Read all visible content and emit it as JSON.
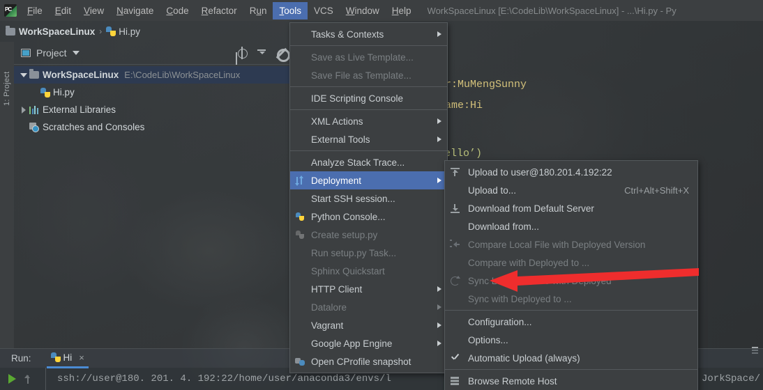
{
  "window": {
    "title": "WorkSpaceLinux [E:\\CodeLib\\WorkSpaceLinux] - ...\\Hi.py - Py"
  },
  "menubar": {
    "items": [
      {
        "label": "File",
        "mnemonic": "F"
      },
      {
        "label": "Edit",
        "mnemonic": "E"
      },
      {
        "label": "View",
        "mnemonic": "V"
      },
      {
        "label": "Navigate",
        "mnemonic": "N"
      },
      {
        "label": "Code",
        "mnemonic": "C"
      },
      {
        "label": "Refactor",
        "mnemonic": "R"
      },
      {
        "label": "Run",
        "mnemonic": "u"
      },
      {
        "label": "Tools",
        "mnemonic": "T",
        "active": true
      },
      {
        "label": "VCS",
        "mnemonic": ""
      },
      {
        "label": "Window",
        "mnemonic": "W"
      },
      {
        "label": "Help",
        "mnemonic": "H"
      }
    ]
  },
  "breadcrumb": {
    "project": "WorkSpaceLinux",
    "separator": "›",
    "file": "Hi.py"
  },
  "project_tool_window": {
    "vertical_tab": "1: Project",
    "title": "Project",
    "tree": [
      {
        "name": "WorkSpaceLinux",
        "path": "E:\\CodeLib\\WorkSpaceLinux",
        "selected": true
      },
      {
        "name": "Hi.py",
        "path": "",
        "selected": false
      },
      {
        "name": "External Libraries",
        "path": "",
        "selected": false
      },
      {
        "name": "Scratches and Consoles",
        "path": "",
        "selected": false
      }
    ]
  },
  "editor": {
    "line1": "r:MuMengSunny",
    "line2": "ame:Hi",
    "line3": "hello’)"
  },
  "tools_menu": {
    "items": [
      {
        "label": "Tasks & Contexts",
        "mnemonic": "T",
        "submenu": true,
        "disabled": false,
        "icon": ""
      },
      {
        "separator": true
      },
      {
        "label": "Save as Live Template...",
        "mnemonic": "i",
        "submenu": false,
        "disabled": true,
        "icon": ""
      },
      {
        "label": "Save File as Template...",
        "mnemonic": "l",
        "submenu": false,
        "disabled": true,
        "icon": ""
      },
      {
        "separator": true
      },
      {
        "label": "IDE Scripting Console",
        "mnemonic": "",
        "submenu": false,
        "disabled": false,
        "icon": ""
      },
      {
        "separator": true
      },
      {
        "label": "XML Actions",
        "mnemonic": "",
        "submenu": true,
        "disabled": false,
        "icon": ""
      },
      {
        "label": "External Tools",
        "mnemonic": "",
        "submenu": true,
        "disabled": false,
        "icon": ""
      },
      {
        "separator": true
      },
      {
        "label": "Analyze Stack Trace...",
        "mnemonic": "S",
        "submenu": false,
        "disabled": false,
        "icon": ""
      },
      {
        "label": "Deployment",
        "mnemonic": "e",
        "submenu": true,
        "disabled": false,
        "highlighted": true,
        "icon": "deployment-icon"
      },
      {
        "label": "Start SSH session...",
        "mnemonic": "",
        "submenu": false,
        "disabled": false,
        "icon": ""
      },
      {
        "label": "Python Console...",
        "mnemonic": "",
        "submenu": false,
        "disabled": false,
        "icon": "python-icon"
      },
      {
        "label": "Create setup.py",
        "mnemonic": "",
        "submenu": false,
        "disabled": true,
        "icon": "python-gray-icon"
      },
      {
        "label": "Run setup.py Task...",
        "mnemonic": "",
        "submenu": false,
        "disabled": true,
        "icon": ""
      },
      {
        "label": "Sphinx Quickstart",
        "mnemonic": "",
        "submenu": false,
        "disabled": true,
        "icon": ""
      },
      {
        "label": "HTTP Client",
        "mnemonic": "",
        "submenu": true,
        "disabled": false,
        "icon": ""
      },
      {
        "label": "Datalore",
        "mnemonic": "",
        "submenu": true,
        "disabled": true,
        "icon": ""
      },
      {
        "label": "Vagrant",
        "mnemonic": "",
        "submenu": true,
        "disabled": false,
        "icon": ""
      },
      {
        "label": "Google App Engine",
        "mnemonic": "",
        "submenu": true,
        "disabled": false,
        "icon": ""
      },
      {
        "label": "Open CProfile snapshot",
        "mnemonic": "",
        "submenu": false,
        "disabled": false,
        "icon": "cprofile-icon"
      }
    ]
  },
  "deployment_menu": {
    "items": [
      {
        "label": "Upload to user@180.201.4.192:22",
        "mnemonic": "U",
        "shortcut": "",
        "disabled": false,
        "icon": "upload-icon"
      },
      {
        "label": "Upload to...",
        "mnemonic": "",
        "shortcut": "Ctrl+Alt+Shift+X",
        "disabled": false,
        "icon": ""
      },
      {
        "label": "Download from Default Server",
        "mnemonic": "",
        "shortcut": "",
        "disabled": false,
        "icon": "download-icon"
      },
      {
        "label": "Download from...",
        "mnemonic": "",
        "shortcut": "",
        "disabled": false,
        "icon": ""
      },
      {
        "label": "Compare Local File with Deployed Version",
        "mnemonic": "",
        "shortcut": "",
        "disabled": true,
        "icon": "compare-icon"
      },
      {
        "label": "Compare with Deployed to ...",
        "mnemonic": "",
        "shortcut": "",
        "disabled": true,
        "icon": ""
      },
      {
        "label": "Sync Local Subtree with Deployed",
        "mnemonic": "",
        "shortcut": "",
        "disabled": true,
        "icon": "sync-icon"
      },
      {
        "label": "Sync with Deployed to ...",
        "mnemonic": "",
        "shortcut": "",
        "disabled": true,
        "icon": ""
      },
      {
        "separator": true
      },
      {
        "label": "Configuration...",
        "mnemonic": "",
        "shortcut": "",
        "disabled": false,
        "icon": ""
      },
      {
        "label": "Options...",
        "mnemonic": "",
        "shortcut": "",
        "disabled": false,
        "icon": ""
      },
      {
        "label": "Automatic Upload (always)",
        "mnemonic": "A",
        "shortcut": "",
        "disabled": false,
        "icon": "check-icon",
        "checked": true
      },
      {
        "separator": true
      },
      {
        "label": "Browse Remote Host",
        "mnemonic": "B",
        "shortcut": "",
        "disabled": false,
        "icon": "remote-host-icon"
      }
    ]
  },
  "annotation": {
    "arrow_color": "#ef2d2d"
  },
  "run_panel": {
    "label": "Run:",
    "tab_name": "Hi",
    "close_glyph": "×",
    "console_line": "ssh://user@180. 201. 4. 192:22/home/user/anaconda3/envs/l",
    "console_tail": "JorkSpace/"
  }
}
